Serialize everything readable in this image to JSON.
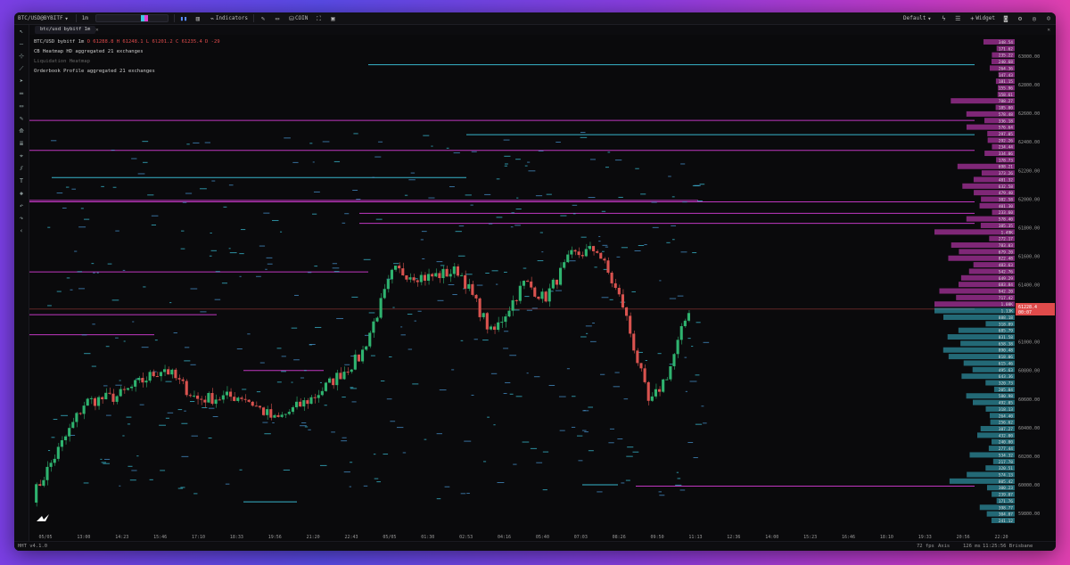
{
  "toolbar": {
    "symbol": "BTC/USD@BYBITF",
    "timeframe": "1m",
    "indicators_label": "Indicators",
    "coin_label": "COIN",
    "layout_label": "Default",
    "widget_label": "Widget"
  },
  "tab": {
    "label": "btc/usd bybitf 1m"
  },
  "legend": {
    "symbol_line": "BTC/USD bybitf 1m",
    "ohlc": "O 61288.8  H 61248.1  L 6l201.2  C 61235.4  D -29",
    "studies": [
      "CB Heatmap HD aggregated 21 exchanges",
      "Liquidation Heatmap",
      "Orderbook Profile aggregated 21 exchanges"
    ]
  },
  "price_axis": {
    "ticks": [
      "63000.00",
      "62800.00",
      "62600.00",
      "62400.00",
      "62200.00",
      "62000.00",
      "61800.00",
      "61600.00",
      "61400.00",
      "61200.00",
      "61000.00",
      "60800.00",
      "60600.00",
      "60400.00",
      "60200.00",
      "60000.00",
      "59800.00"
    ],
    "current_price": "61228.4",
    "current_delta": "00:07"
  },
  "time_axis": {
    "ticks": [
      "05/05",
      "13:00",
      "14:23",
      "15:46",
      "17:10",
      "18:33",
      "19:56",
      "21:20",
      "22:43",
      "05/05",
      "01:30",
      "02:53",
      "04:16",
      "05:40",
      "07:03",
      "08:26",
      "09:50",
      "11:13",
      "12:36",
      "14:00",
      "15:23",
      "16:46",
      "18:10",
      "19:33",
      "20:56",
      "22:20"
    ]
  },
  "profile_labels": [
    "348.54",
    "171.62",
    "235.22",
    "240.68",
    "264.36",
    "147.43",
    "181.15",
    "155.96",
    "158.61",
    "788.27",
    "185.00",
    "578.48",
    "336.18",
    "576.64",
    "297.05",
    "292.26",
    "234.44",
    "334.06",
    "178.73",
    "698.21",
    "373.26",
    "481.32",
    "632.58",
    "479.40",
    "382.58",
    "401.30",
    "233.60",
    "578.40",
    "385.35",
    "1.49K",
    "272.17",
    "783.03",
    "679.20",
    "822.48",
    "483.63",
    "542.76",
    "649.29",
    "683.84",
    "942.20",
    "717.42",
    "1.08K",
    "1.13K",
    "888.18",
    "318.89",
    "685.79",
    "831.58",
    "658.38",
    "890.48",
    "818.06",
    "615.46",
    "495.63",
    "643.36",
    "320.73",
    "205.04",
    "580.98",
    "492.05",
    "318.13",
    "264.40",
    "256.62",
    "387.27",
    "432.00",
    "240.00",
    "277.44",
    "534.32",
    "217.78",
    "320.51",
    "574.13",
    "805.42",
    "300.23",
    "239.07",
    "171.76",
    "398.77",
    "304.07",
    "241.12"
  ],
  "status": {
    "version": "HHT v4.1.0",
    "fps": "72 fps",
    "axis": "Axis",
    "latency": "126 ms",
    "clock": "11:25:56 Brisbane (UTC+10)"
  },
  "colors": {
    "background": "#0a0a0c",
    "ask_profile": "#e040d0",
    "bid_profile": "#3cc8e0",
    "current_price": "#e04b4b",
    "level_line_magenta": "#d43cd4",
    "level_line_cyan": "#3cc8e0"
  },
  "icons": [
    "chevron-down-icon",
    "candles-icon",
    "chart-type-icon",
    "indicators-icon",
    "pencil-icon",
    "folder-icon",
    "coin-icon",
    "fullscreen-icon",
    "camera-icon",
    "lightning-icon",
    "list-icon",
    "plus-icon",
    "settings-icon",
    "gamepad-icon",
    "user-icon",
    "cursor-icon",
    "crosshair-icon",
    "measure-icon",
    "line-icon",
    "arrow-icon",
    "rect-icon",
    "pencil-icon",
    "pattern-icon",
    "fib-icon",
    "ruler-icon",
    "text-icon",
    "layers-icon",
    "undo-icon",
    "redo-icon",
    "collapse-icon",
    "logo-icon"
  ]
}
